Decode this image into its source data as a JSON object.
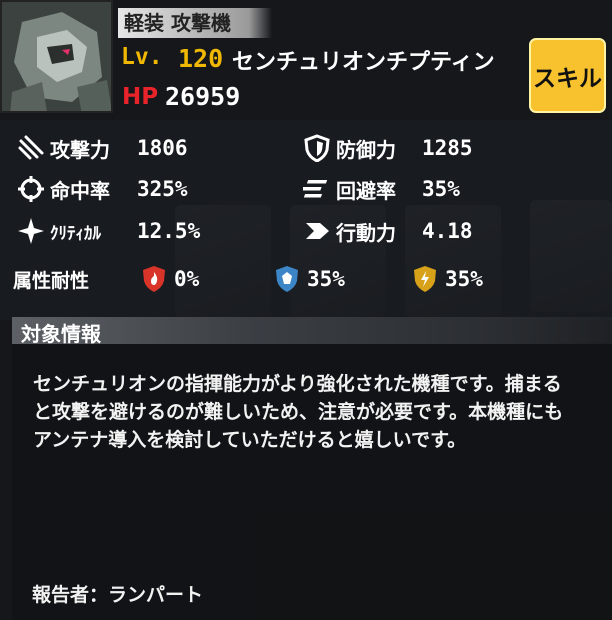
{
  "unit": {
    "class": "軽装 攻撃機",
    "level_label": "Lv.",
    "level": "120",
    "name": "センチュリオンチプティン",
    "hp_label": "HP",
    "hp": "26959"
  },
  "skill_button": "スキル",
  "stats": {
    "attack": {
      "label": "攻撃力",
      "value": "1806",
      "icon": "missile-icon"
    },
    "defense": {
      "label": "防御力",
      "value": "1285",
      "icon": "shield-icon"
    },
    "accuracy": {
      "label": "命中率",
      "value": "325%",
      "icon": "crosshair-icon"
    },
    "evasion": {
      "label": "回避率",
      "value": "35%",
      "icon": "evasion-lines-icon"
    },
    "critical": {
      "label": "ｸﾘﾃｨｶﾙ",
      "value": "12.5%",
      "icon": "sparkle-icon"
    },
    "action": {
      "label": "行動力",
      "value": "4.18",
      "icon": "chevron-right-icon"
    }
  },
  "resistance": {
    "label": "属性耐性",
    "fire": {
      "value": "0%",
      "color": "#d9342a",
      "icon": "fire-shield-icon"
    },
    "ice": {
      "value": "35%",
      "color": "#3c86c8",
      "icon": "ice-shield-icon"
    },
    "electric": {
      "value": "35%",
      "color": "#d7a21a",
      "icon": "lightning-shield-icon"
    }
  },
  "info": {
    "title": "対象情報",
    "description": "センチュリオンの指揮能力がより強化された機種です。捕まると攻撃を避けるのが難しいため、注意が必要です。本機種にもアンテナ導入を検討していただけると嬉しいです。",
    "reporter": "報告者：ランパート"
  },
  "colors": {
    "accent_yellow": "#f7c22d",
    "level_gold": "#f0b800",
    "hp_red": "#e8242a"
  }
}
